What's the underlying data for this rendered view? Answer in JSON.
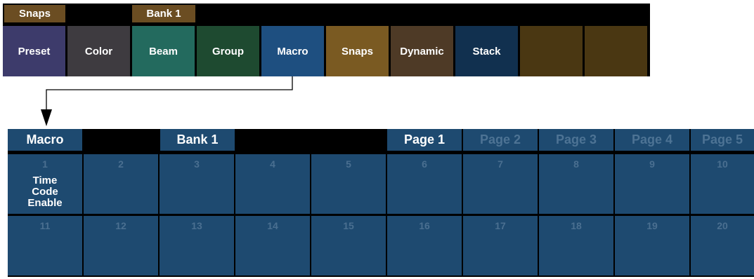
{
  "toolbar": {
    "snaps_tag": "Snaps",
    "bank_tag": "Bank 1",
    "tabs": [
      {
        "label": "Preset",
        "color": "#3d3b6b"
      },
      {
        "label": "Color",
        "color": "#3e3b40"
      },
      {
        "label": "Beam",
        "color": "#236a5e"
      },
      {
        "label": "Group",
        "color": "#1e4a30"
      },
      {
        "label": "Macro",
        "color": "#1e4f80"
      },
      {
        "label": "Snaps",
        "color": "#7a5a22"
      },
      {
        "label": "Dynamic",
        "color": "#4e3a26"
      },
      {
        "label": "Stack",
        "color": "#11304f"
      },
      {
        "label": "",
        "color": "#4a3712"
      },
      {
        "label": "",
        "color": "#4a3712"
      }
    ]
  },
  "macro": {
    "title": "Macro",
    "bank": "Bank 1",
    "pages": [
      "Page 1",
      "Page 2",
      "Page 3",
      "Page 4",
      "Page 5"
    ],
    "active_page": "Page 1",
    "cells": [
      {
        "number": "1",
        "label": "Time\nCode\nEnable"
      },
      {
        "number": "2",
        "label": ""
      },
      {
        "number": "3",
        "label": ""
      },
      {
        "number": "4",
        "label": ""
      },
      {
        "number": "5",
        "label": ""
      },
      {
        "number": "6",
        "label": ""
      },
      {
        "number": "7",
        "label": ""
      },
      {
        "number": "8",
        "label": ""
      },
      {
        "number": "9",
        "label": ""
      },
      {
        "number": "10",
        "label": ""
      },
      {
        "number": "11",
        "label": ""
      },
      {
        "number": "12",
        "label": ""
      },
      {
        "number": "13",
        "label": ""
      },
      {
        "number": "14",
        "label": ""
      },
      {
        "number": "15",
        "label": ""
      },
      {
        "number": "16",
        "label": ""
      },
      {
        "number": "17",
        "label": ""
      },
      {
        "number": "18",
        "label": ""
      },
      {
        "number": "19",
        "label": ""
      },
      {
        "number": "20",
        "label": ""
      }
    ]
  }
}
